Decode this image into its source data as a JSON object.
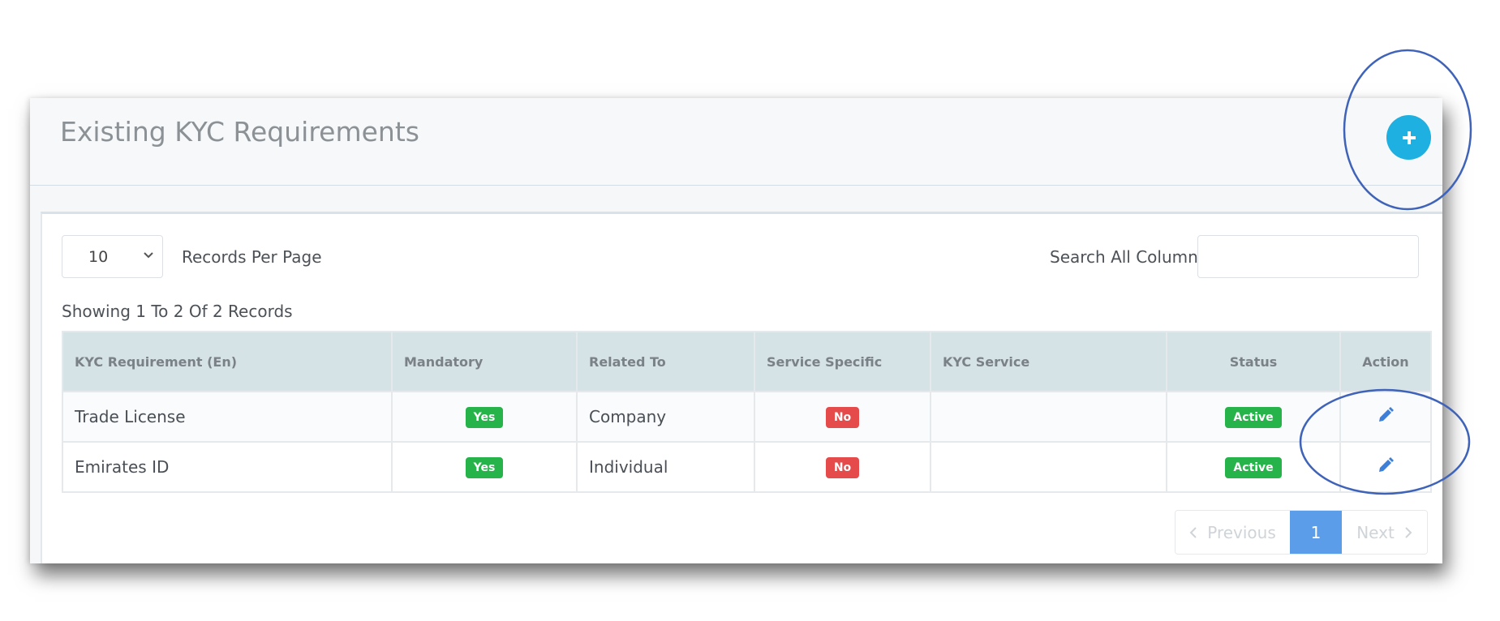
{
  "header": {
    "title": "Existing KYC Requirements",
    "add_icon": "plus-icon"
  },
  "controls": {
    "per_page_value": "10",
    "per_page_label": "Records Per Page",
    "search_label": "Search All Columns",
    "search_value": "",
    "showing_text": "Showing 1 To 2 Of 2 Records"
  },
  "table": {
    "columns": [
      "KYC Requirement (En)",
      "Mandatory",
      "Related To",
      "Service Specific",
      "KYC Service",
      "Status",
      "Action"
    ],
    "rows": [
      {
        "requirement": "Trade License",
        "mandatory": "Yes",
        "related_to": "Company",
        "service_specific": "No",
        "kyc_service": "",
        "status": "Active",
        "action_icon": "pencil-icon"
      },
      {
        "requirement": "Emirates ID",
        "mandatory": "Yes",
        "related_to": "Individual",
        "service_specific": "No",
        "kyc_service": "",
        "status": "Active",
        "action_icon": "pencil-icon"
      }
    ]
  },
  "pagination": {
    "previous_label": "Previous",
    "current_page": "1",
    "next_label": "Next"
  },
  "colors": {
    "accent": "#1db0e0",
    "yes_badge": "#25b34a",
    "no_badge": "#e64b4b",
    "active_page": "#5b9de9",
    "annotation_circle": "#3f63b8"
  }
}
